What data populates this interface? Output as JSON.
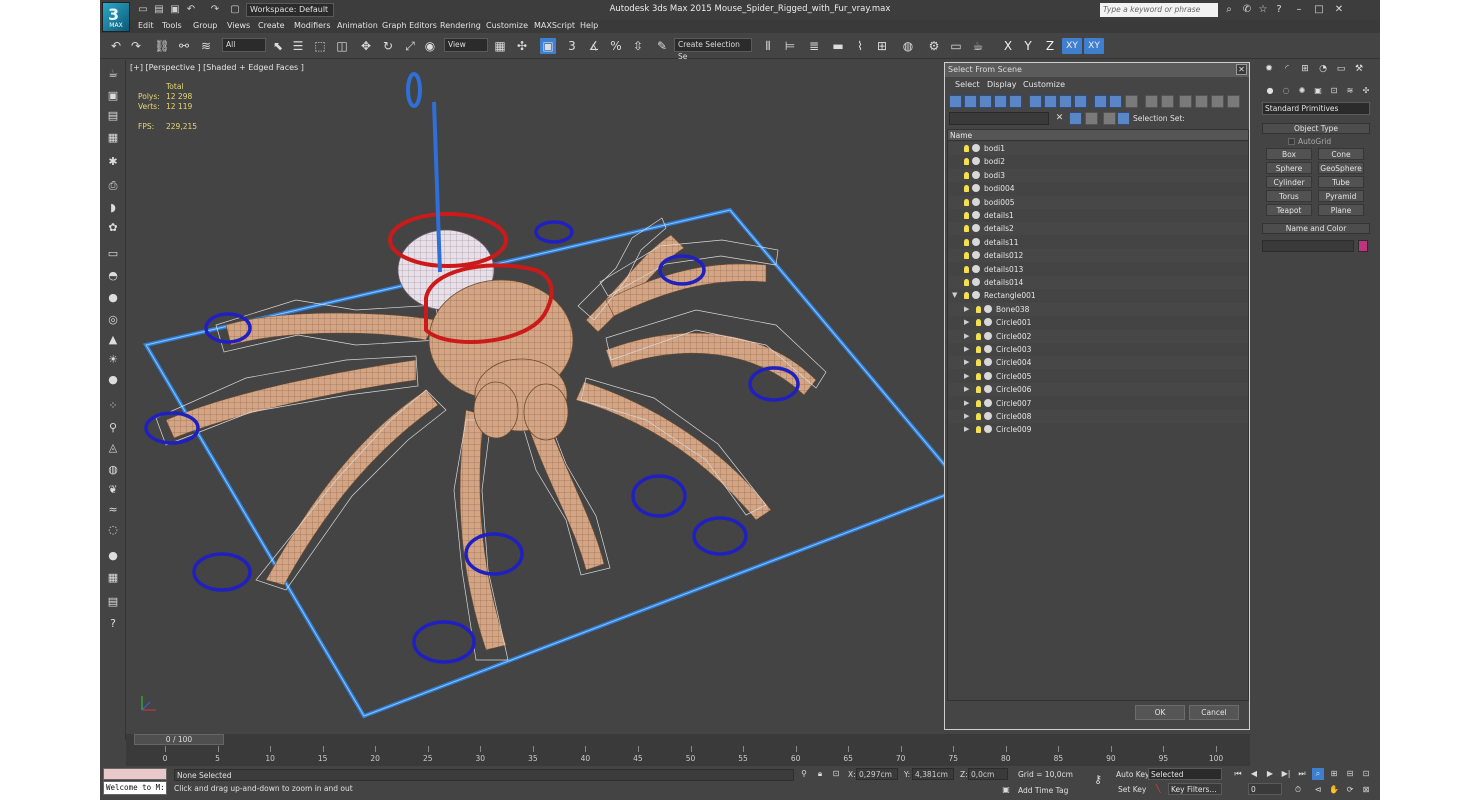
{
  "titlebar": {
    "workspace": "Workspace: Default",
    "title": "Autodesk 3ds Max  2015    Mouse_Spider_Rigged_with_Fur_vray.max",
    "search_placeholder": "Type a keyword or phrase",
    "logo_text": "MAX"
  },
  "menu": [
    "Edit",
    "Tools",
    "Group",
    "Views",
    "Create",
    "Modifiers",
    "Animation",
    "Graph Editors",
    "Rendering",
    "Customize",
    "MAXScript",
    "Help"
  ],
  "toolbar": {
    "filter_all": "All",
    "ref_coord": "View",
    "snap_label": "3",
    "named_selection": "Create Selection Se",
    "axis_x": "X",
    "axis_y": "Y",
    "axis_z": "Z",
    "axis_xy": "XY",
    "axis_xy2": "XY"
  },
  "viewport": {
    "label": "[+] [Perspective ] [Shaded + Edged Faces ]",
    "stats": {
      "total_label": "Total",
      "polys_label": "Polys:",
      "polys": "12 298",
      "verts_label": "Verts:",
      "verts": "12 119",
      "fps_label": "FPS:",
      "fps": "229,215"
    }
  },
  "timeline": {
    "frame": "0 / 100",
    "ticks": [
      "0",
      "5",
      "10",
      "15",
      "20",
      "25",
      "30",
      "35",
      "40",
      "45",
      "50",
      "55",
      "60",
      "65",
      "70",
      "75",
      "80",
      "85",
      "90",
      "95",
      "100"
    ]
  },
  "status": {
    "maxscript": "Welcome to M:",
    "none_selected": "None Selected",
    "prompt": "Click and drag up-and-down to zoom in and out",
    "x_label": "X:",
    "x": "0,297cm",
    "y_label": "Y:",
    "y": "4,381cm",
    "z_label": "Z:",
    "z": "0,0cm",
    "grid": "Grid = 10,0cm",
    "add_time_tag": "Add Time Tag",
    "auto_key": "Auto Key",
    "set_key": "Set Key",
    "selected": "Selected",
    "key_filters": "Key Filters...",
    "frame_field": "0"
  },
  "scene_dialog": {
    "title": "Select From Scene",
    "menu": [
      "Select",
      "Display",
      "Customize"
    ],
    "selection_set": "Selection Set:",
    "column": "Name",
    "items": [
      {
        "name": "bodi1",
        "level": 0,
        "expand": ""
      },
      {
        "name": "bodi2",
        "level": 0,
        "expand": ""
      },
      {
        "name": "bodi3",
        "level": 0,
        "expand": ""
      },
      {
        "name": "bodi004",
        "level": 0,
        "expand": ""
      },
      {
        "name": "bodi005",
        "level": 0,
        "expand": ""
      },
      {
        "name": "details1",
        "level": 0,
        "expand": ""
      },
      {
        "name": "details2",
        "level": 0,
        "expand": ""
      },
      {
        "name": "details11",
        "level": 0,
        "expand": ""
      },
      {
        "name": "details012",
        "level": 0,
        "expand": ""
      },
      {
        "name": "details013",
        "level": 0,
        "expand": ""
      },
      {
        "name": "details014",
        "level": 0,
        "expand": ""
      },
      {
        "name": "Rectangle001",
        "level": 0,
        "expand": "▼"
      },
      {
        "name": "Bone038",
        "level": 1,
        "expand": "▶"
      },
      {
        "name": "Circle001",
        "level": 1,
        "expand": "▶"
      },
      {
        "name": "Circle002",
        "level": 1,
        "expand": "▶"
      },
      {
        "name": "Circle003",
        "level": 1,
        "expand": "▶"
      },
      {
        "name": "Circle004",
        "level": 1,
        "expand": "▶"
      },
      {
        "name": "Circle005",
        "level": 1,
        "expand": "▶"
      },
      {
        "name": "Circle006",
        "level": 1,
        "expand": "▶"
      },
      {
        "name": "Circle007",
        "level": 1,
        "expand": "▶"
      },
      {
        "name": "Circle008",
        "level": 1,
        "expand": "▶"
      },
      {
        "name": "Circle009",
        "level": 1,
        "expand": "▶"
      }
    ],
    "ok": "OK",
    "cancel": "Cancel"
  },
  "command_panel": {
    "category": "Standard Primitives",
    "object_type": "Object Type",
    "autogrid": "AutoGrid",
    "buttons": [
      "Box",
      "Cone",
      "Sphere",
      "GeoSphere",
      "Cylinder",
      "Tube",
      "Torus",
      "Pyramid",
      "Teapot",
      "Plane"
    ],
    "name_and_color": "Name and Color",
    "object_color": "#c0337e"
  },
  "colors": {
    "viewport_bg": "#444444",
    "spider_skin": "#d4a584",
    "rig_rectangle": "#2f7fd8",
    "foot_controls": "#2020c0",
    "body_controls": "#cc1a1a",
    "stats_text": "#e8d870",
    "active_blue": "#3f7fd0"
  }
}
